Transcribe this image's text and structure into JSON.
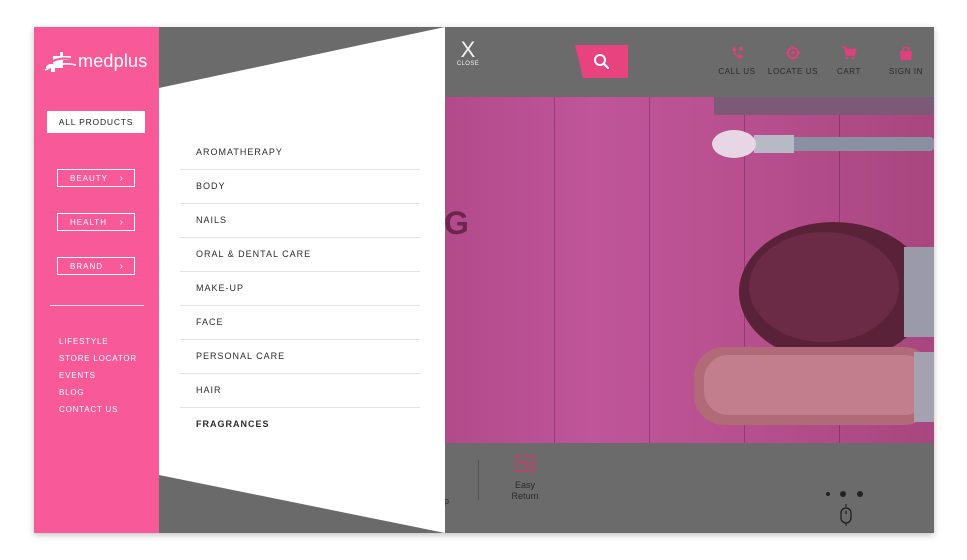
{
  "brand": {
    "name": "medplus"
  },
  "header": {
    "close_label": "CLOSE",
    "close_glyph": "X",
    "search_icon": "search-icon",
    "actions": [
      {
        "label": "CALL US",
        "icon": "call-icon"
      },
      {
        "label": "LOCATE US",
        "icon": "locate-icon"
      },
      {
        "label": "CART",
        "icon": "cart-icon"
      },
      {
        "label": "SIGN IN",
        "icon": "sign-in-icon"
      }
    ]
  },
  "sidebar": {
    "all_products": "ALL PRODUCTS",
    "categories": [
      {
        "label": "BEAUTY",
        "icon": "chevron-right-icon"
      },
      {
        "label": "HEALTH",
        "icon": "chevron-right-icon"
      },
      {
        "label": "BRAND",
        "icon": "chevron-right-icon"
      }
    ],
    "links": [
      "LIFESTYLE",
      "STORE LOCATOR",
      "EVENTS",
      "BLOG",
      "CONTACT US"
    ]
  },
  "submenu": {
    "items": [
      "AROMATHERAPY",
      "BODY",
      "NAILS",
      "ORAL & DENTAL CARE",
      "MAKE-UP",
      "FACE",
      "PERSONAL CARE",
      "HAIR",
      "FRAGRANCES"
    ]
  },
  "background": {
    "hero_fragment": "G",
    "feature_label_line1": "Easy",
    "feature_label_line2": "Return",
    "feature_fragment": "p"
  },
  "colors": {
    "accent": "#f85a97",
    "overlay": "#6b6b6b",
    "hero": "#b8508f"
  }
}
